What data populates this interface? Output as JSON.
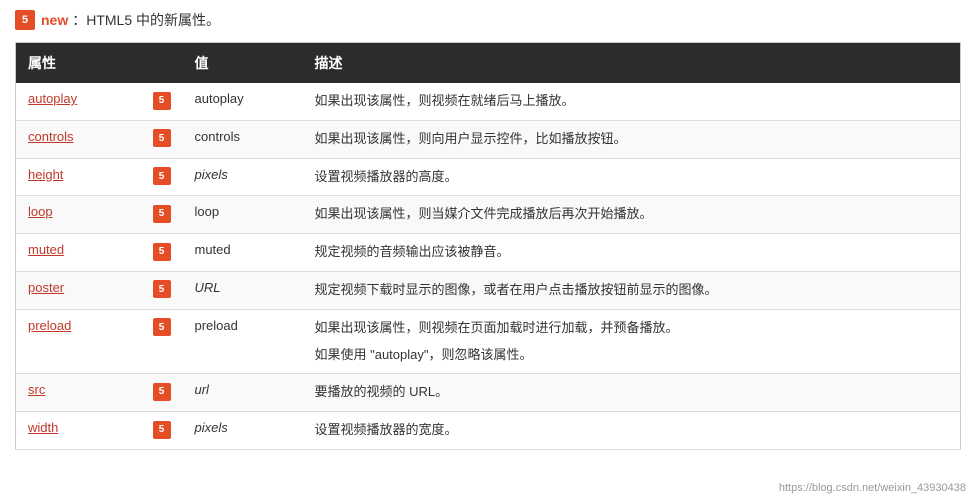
{
  "note": {
    "badge": "5",
    "keyword": "new",
    "text": "：HTML5 中的新属性。"
  },
  "table": {
    "headers": [
      "属性",
      "",
      "值",
      "描述"
    ],
    "rows": [
      {
        "attr": "autoplay",
        "has_badge": true,
        "badge": "5",
        "value": "autoplay",
        "value_italic": false,
        "desc": "如果出现该属性，则视频在就绪后马上播放。",
        "desc2": null
      },
      {
        "attr": "controls",
        "has_badge": true,
        "badge": "5",
        "value": "controls",
        "value_italic": false,
        "desc": "如果出现该属性，则向用户显示控件，比如播放按钮。",
        "desc2": null
      },
      {
        "attr": "height",
        "has_badge": true,
        "badge": "5",
        "value": "pixels",
        "value_italic": true,
        "desc": "设置视频播放器的高度。",
        "desc2": null
      },
      {
        "attr": "loop",
        "has_badge": true,
        "badge": "5",
        "value": "loop",
        "value_italic": false,
        "desc": "如果出现该属性，则当媒介文件完成播放后再次开始播放。",
        "desc2": null
      },
      {
        "attr": "muted",
        "has_badge": true,
        "badge": "5",
        "value": "muted",
        "value_italic": false,
        "desc": "规定视频的音频输出应该被静音。",
        "desc2": null
      },
      {
        "attr": "poster",
        "has_badge": true,
        "badge": "5",
        "value": "URL",
        "value_italic": true,
        "desc": "规定视频下载时显示的图像，或者在用户点击播放按钮前显示的图像。",
        "desc2": null
      },
      {
        "attr": "preload",
        "has_badge": true,
        "badge": "5",
        "value": "preload",
        "value_italic": false,
        "desc": "如果出现该属性，则视频在页面加载时进行加载，并预备播放。",
        "desc2": "如果使用 \"autoplay\"，则忽略该属性。"
      },
      {
        "attr": "src",
        "has_badge": true,
        "badge": "5",
        "value": "url",
        "value_italic": true,
        "desc": "要播放的视频的 URL。",
        "desc2": null
      },
      {
        "attr": "width",
        "has_badge": true,
        "badge": "5",
        "value": "pixels",
        "value_italic": true,
        "desc": "设置视频播放器的宽度。",
        "desc2": null
      }
    ]
  },
  "footer": {
    "link": "https://blog.csdn.net/weixin_43930438"
  }
}
